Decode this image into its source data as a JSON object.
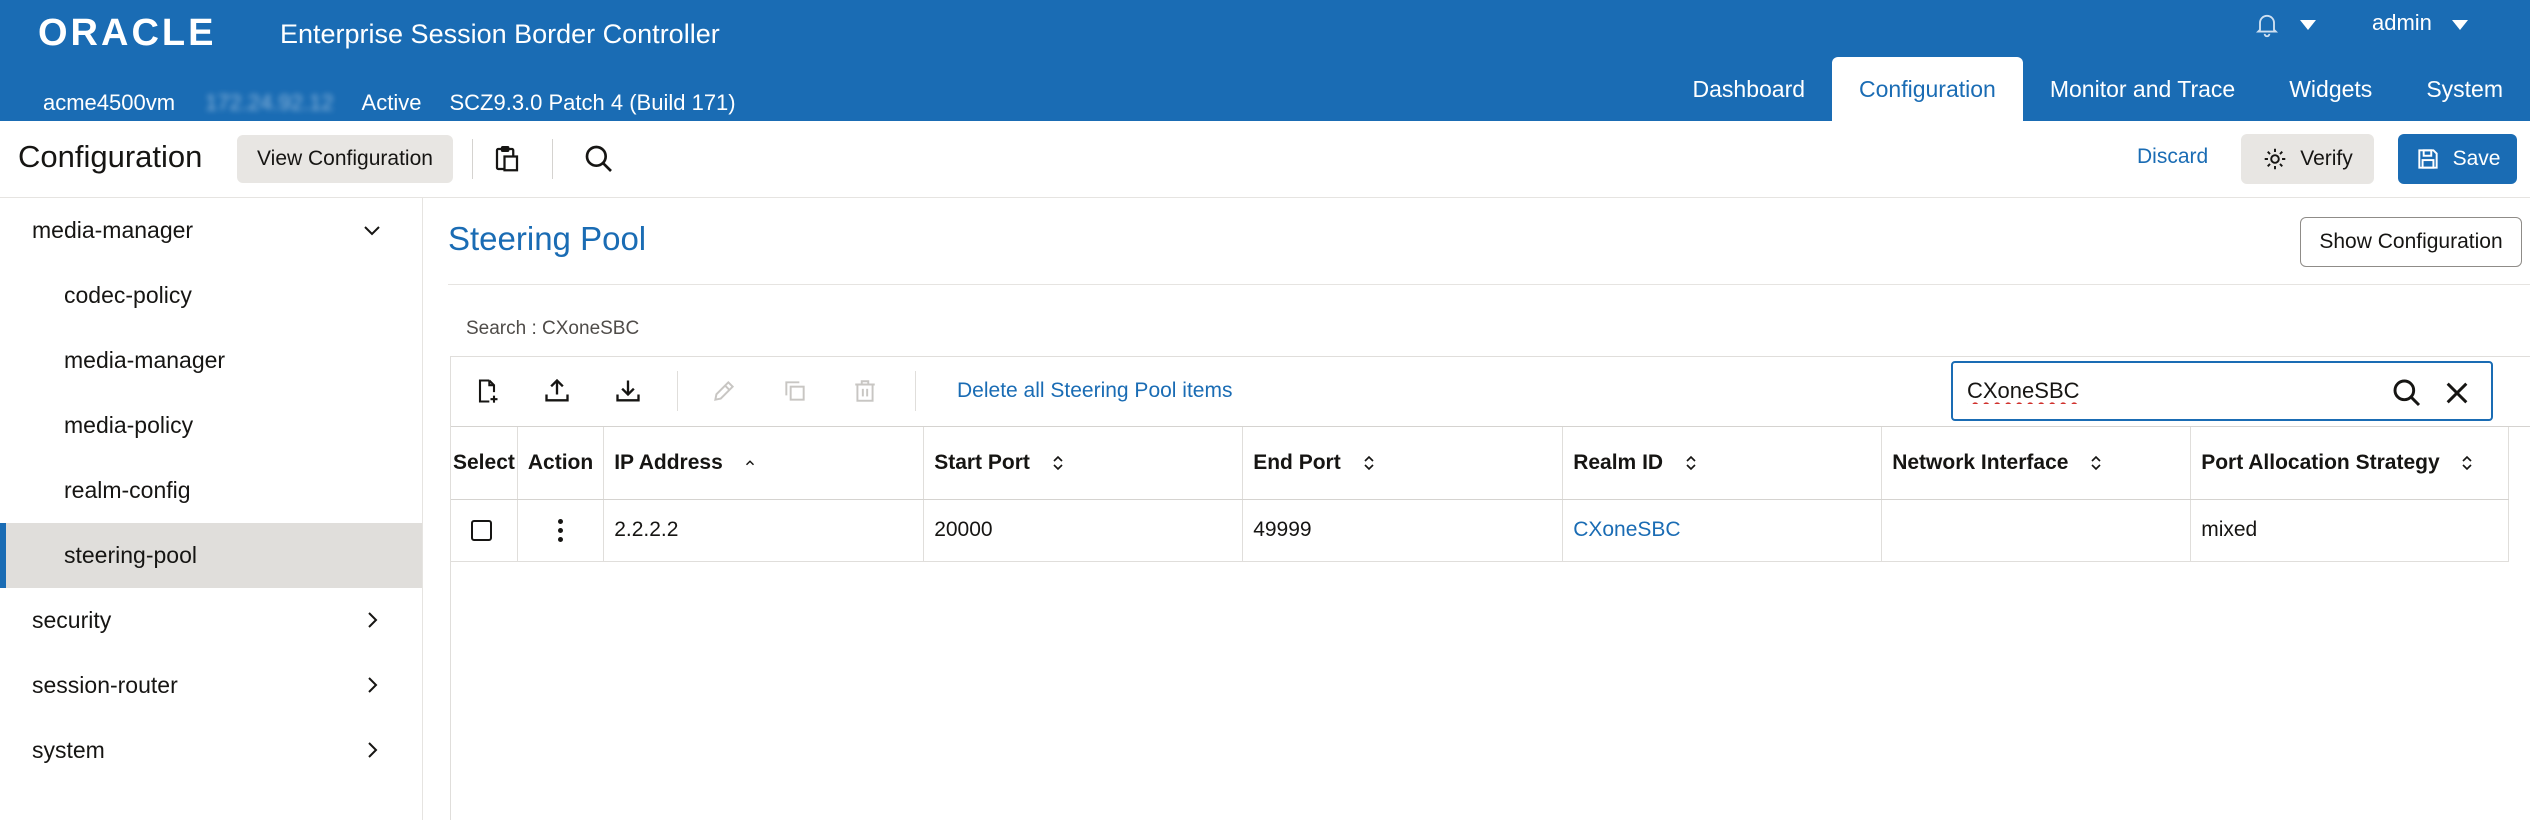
{
  "header": {
    "logo": "ORACLE",
    "product": "Enterprise Session Border Controller",
    "user": "admin",
    "hostname": "acme4500vm",
    "ip_address": "172.24.92.12",
    "state": "Active",
    "version": "SCZ9.3.0 Patch 4 (Build 171)",
    "tabs": [
      {
        "label": "Dashboard"
      },
      {
        "label": "Configuration"
      },
      {
        "label": "Monitor and Trace"
      },
      {
        "label": "Widgets"
      },
      {
        "label": "System"
      }
    ],
    "active_tab": "Configuration",
    "colors": {
      "brand": "#1a6cb4"
    }
  },
  "toolbar": {
    "title": "Configuration",
    "view_configuration": "View Configuration",
    "discard": "Discard",
    "verify": "Verify",
    "save": "Save",
    "icons": [
      "clipboard-icon",
      "search-icon",
      "verify-gear-icon",
      "save-floppy-icon"
    ]
  },
  "sidebar": {
    "items": [
      {
        "label": "media-manager",
        "expanded": true
      },
      {
        "label": "codec-policy"
      },
      {
        "label": "media-manager"
      },
      {
        "label": "media-policy"
      },
      {
        "label": "realm-config"
      },
      {
        "label": "steering-pool",
        "selected": true
      },
      {
        "label": "security"
      },
      {
        "label": "session-router"
      },
      {
        "label": "system"
      }
    ]
  },
  "main": {
    "title": "Steering Pool",
    "show_configuration": "Show Configuration",
    "search_label": "Search : CXoneSBC",
    "delete_all": "Delete all Steering Pool items",
    "search_value": "CXoneSBC",
    "table": {
      "columns": [
        "Select",
        "Action",
        "IP Address",
        "Start Port",
        "End Port",
        "Realm ID",
        "Network Interface",
        "Port Allocation Strategy"
      ],
      "rows": [
        {
          "ip_address": "2.2.2.2",
          "start_port": "20000",
          "end_port": "49999",
          "realm_id": "CXoneSBC",
          "network_interface": "",
          "port_allocation_strategy": "mixed"
        }
      ]
    }
  }
}
